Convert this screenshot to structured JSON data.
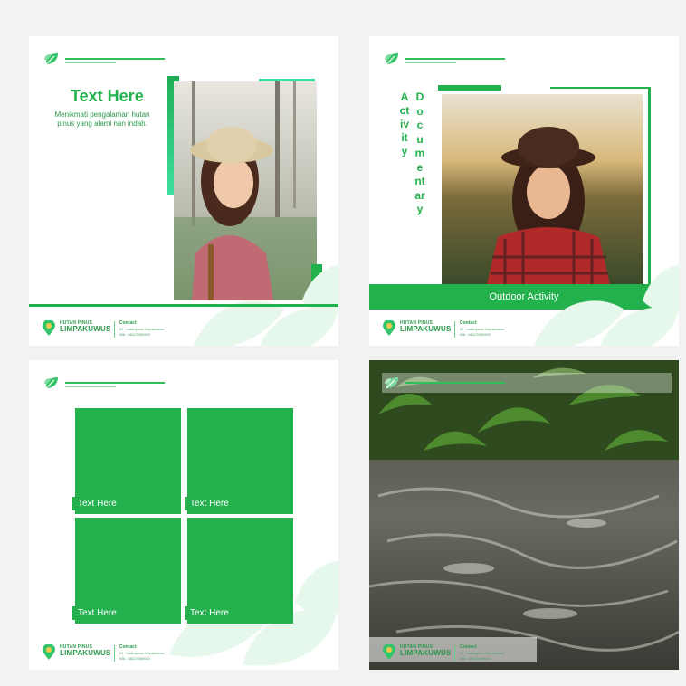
{
  "card1": {
    "title": "Text Here",
    "body": "Menikmati pengalaman hutan pinus yang alami nan indah."
  },
  "card2": {
    "vertical_word_1": "Activity",
    "vertical_word_2": "Documentary",
    "banner": "Outdoor Activity"
  },
  "card3": {
    "tiles": [
      "Text Here",
      "Text Here",
      "Text Here",
      "Text Here"
    ]
  },
  "footer": {
    "brand_top": "HUTAN PINUS",
    "brand_main": "LIMPAKUWUS",
    "contact_label": "Contact",
    "contact_line1": "IG : hutanpinus limpakuwus",
    "contact_line2": "WA : 08127600000"
  },
  "colors": {
    "primary_green": "#22b14c",
    "accent_gradient_end": "#3ee0a0",
    "background": "#f2f2f2"
  },
  "icons": [
    "leaf-icon",
    "location-leaf-logo-icon"
  ]
}
